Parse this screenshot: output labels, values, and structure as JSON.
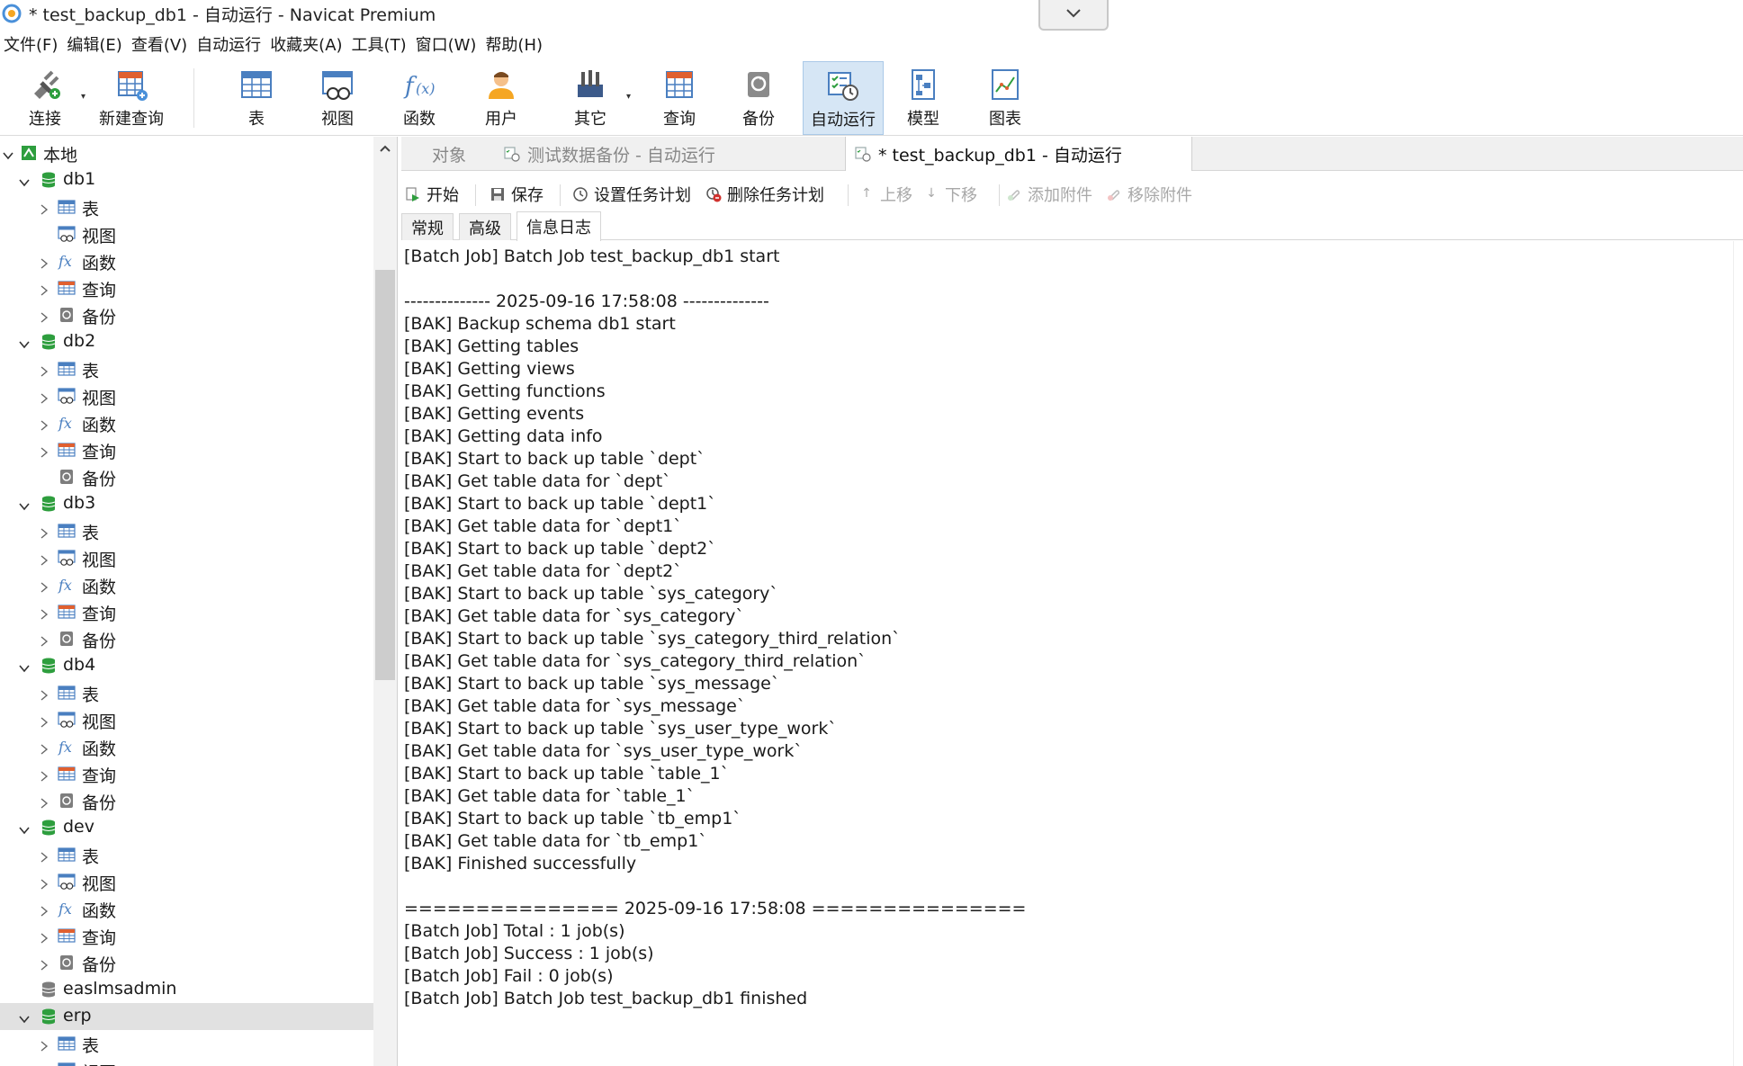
{
  "window": {
    "title": "* test_backup_db1 - 自动运行 - Navicat Premium"
  },
  "menu": [
    "文件(F)",
    "编辑(E)",
    "查看(V)",
    "自动运行",
    "收藏夹(A)",
    "工具(T)",
    "窗口(W)",
    "帮助(H)"
  ],
  "toolbar": {
    "connect": "连接",
    "new_query": "新建查询",
    "table": "表",
    "view": "视图",
    "function": "函数",
    "user": "用户",
    "other": "其它",
    "query": "查询",
    "backup": "备份",
    "automation": "自动运行",
    "model": "模型",
    "chart": "图表"
  },
  "sidebar": {
    "root": "本地",
    "tree": [
      {
        "level": 0,
        "type": "root",
        "label": "本地"
      },
      {
        "level": 1,
        "type": "db",
        "label": "db1"
      },
      {
        "level": 2,
        "type": "table",
        "label": "表"
      },
      {
        "level": 2,
        "type": "view",
        "label": "视图"
      },
      {
        "level": 2,
        "type": "function",
        "label": "函数"
      },
      {
        "level": 2,
        "type": "query",
        "label": "查询"
      },
      {
        "level": 2,
        "type": "backup",
        "label": "备份"
      },
      {
        "level": 1,
        "type": "db",
        "label": "db2"
      },
      {
        "level": 2,
        "type": "table",
        "label": "表"
      },
      {
        "level": 2,
        "type": "view",
        "label": "视图"
      },
      {
        "level": 2,
        "type": "function",
        "label": "函数"
      },
      {
        "level": 2,
        "type": "query",
        "label": "查询"
      },
      {
        "level": 2,
        "type": "backup",
        "label": "备份"
      },
      {
        "level": 1,
        "type": "db",
        "label": "db3"
      },
      {
        "level": 2,
        "type": "table",
        "label": "表"
      },
      {
        "level": 2,
        "type": "view",
        "label": "视图"
      },
      {
        "level": 2,
        "type": "function",
        "label": "函数"
      },
      {
        "level": 2,
        "type": "query",
        "label": "查询"
      },
      {
        "level": 2,
        "type": "backup",
        "label": "备份"
      },
      {
        "level": 1,
        "type": "db",
        "label": "db4"
      },
      {
        "level": 2,
        "type": "table",
        "label": "表"
      },
      {
        "level": 2,
        "type": "view",
        "label": "视图"
      },
      {
        "level": 2,
        "type": "function",
        "label": "函数"
      },
      {
        "level": 2,
        "type": "query",
        "label": "查询"
      },
      {
        "level": 2,
        "type": "backup",
        "label": "备份"
      },
      {
        "level": 1,
        "type": "db",
        "label": "dev"
      },
      {
        "level": 2,
        "type": "table",
        "label": "表"
      },
      {
        "level": 2,
        "type": "view",
        "label": "视图"
      },
      {
        "level": 2,
        "type": "function",
        "label": "函数"
      },
      {
        "level": 2,
        "type": "query",
        "label": "查询"
      },
      {
        "level": 2,
        "type": "backup",
        "label": "备份"
      },
      {
        "level": 1,
        "type": "db-closed",
        "label": "easlmsadmin"
      },
      {
        "level": 1,
        "type": "db",
        "label": "erp"
      },
      {
        "level": 2,
        "type": "table",
        "label": "表"
      },
      {
        "level": 2,
        "type": "view",
        "label": "视图"
      }
    ]
  },
  "tabs": [
    {
      "label": "对象"
    },
    {
      "label": "测试数据备份 - 自动运行"
    },
    {
      "label": "* test_backup_db1 - 自动运行"
    }
  ],
  "actions": {
    "start": "开始",
    "save": "保存",
    "set_schedule": "设置任务计划",
    "delete_schedule": "删除任务计划",
    "move_up": "上移",
    "move_down": "下移",
    "add_attachment": "添加附件",
    "remove_attachment": "移除附件"
  },
  "subtabs": [
    "常规",
    "高级",
    "信息日志"
  ],
  "log_lines": [
    "[Batch Job] Batch Job test_backup_db1 start",
    "",
    "-------------- 2025-09-16 17:58:08 --------------",
    "[BAK] Backup schema db1 start",
    "[BAK] Getting tables",
    "[BAK] Getting views",
    "[BAK] Getting functions",
    "[BAK] Getting events",
    "[BAK] Getting data info",
    "[BAK] Start to back up table `dept`",
    "[BAK] Get table data for `dept`",
    "[BAK] Start to back up table `dept1`",
    "[BAK] Get table data for `dept1`",
    "[BAK] Start to back up table `dept2`",
    "[BAK] Get table data for `dept2`",
    "[BAK] Start to back up table `sys_category`",
    "[BAK] Get table data for `sys_category`",
    "[BAK] Start to back up table `sys_category_third_relation`",
    "[BAK] Get table data for `sys_category_third_relation`",
    "[BAK] Start to back up table `sys_message`",
    "[BAK] Get table data for `sys_message`",
    "[BAK] Start to back up table `sys_user_type_work`",
    "[BAK] Get table data for `sys_user_type_work`",
    "[BAK] Start to back up table `table_1`",
    "[BAK] Get table data for `table_1`",
    "[BAK] Start to back up table `tb_emp1`",
    "[BAK] Get table data for `tb_emp1`",
    "[BAK] Finished successfully",
    "",
    "=============== 2025-09-16 17:58:08 ===============",
    "[Batch Job] Total : 1 job(s)",
    "[Batch Job] Success : 1 job(s)",
    "[Batch Job] Fail : 0 job(s)",
    "[Batch Job] Batch Job test_backup_db1 finished"
  ],
  "colors": {
    "db_green": "#2e9e3e",
    "active_tool_bg": "#d6e6f5",
    "selected_row_bg": "#e1e1e1"
  }
}
